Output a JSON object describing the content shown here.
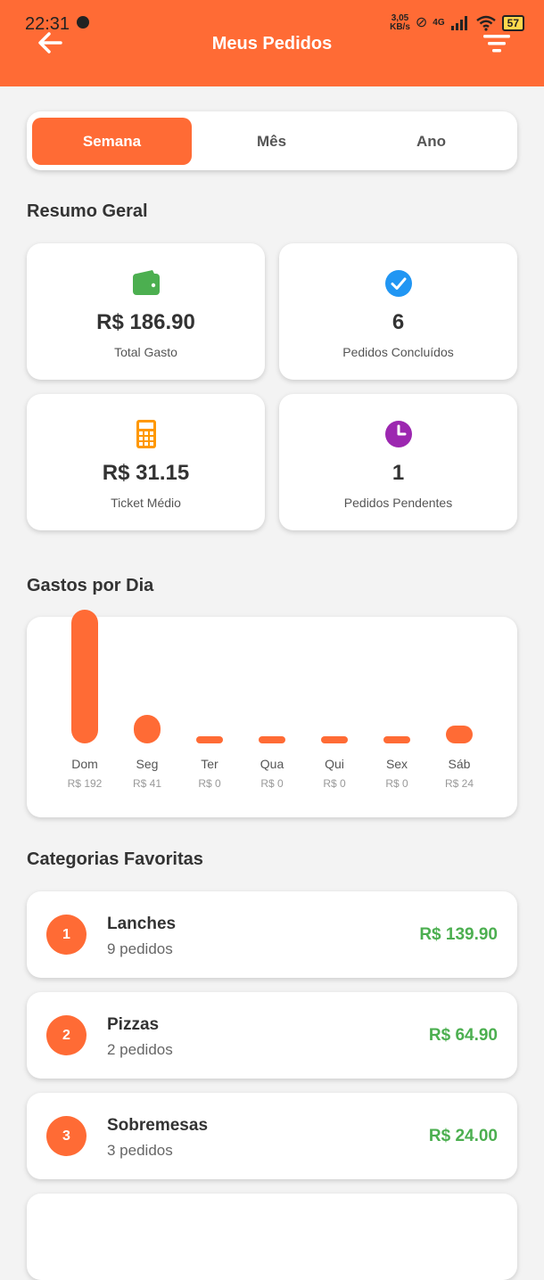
{
  "status": {
    "time": "22:31",
    "speed": "3,05",
    "speed_unit": "KB/s",
    "network": "4G",
    "battery": "57"
  },
  "header": {
    "title": "Meus Pedidos"
  },
  "tabs": [
    {
      "label": "Semana",
      "active": true
    },
    {
      "label": "Mês",
      "active": false
    },
    {
      "label": "Ano",
      "active": false
    }
  ],
  "summary": {
    "title": "Resumo Geral",
    "cards": [
      {
        "value": "R$ 186.90",
        "label": "Total Gasto",
        "icon": "wallet-icon",
        "color": "#4caf50"
      },
      {
        "value": "6",
        "label": "Pedidos Concluídos",
        "icon": "check-circle-icon",
        "color": "#2196f3"
      },
      {
        "value": "R$ 31.15",
        "label": "Ticket Médio",
        "icon": "calculator-icon",
        "color": "#ff9800"
      },
      {
        "value": "1",
        "label": "Pedidos Pendentes",
        "icon": "clock-icon",
        "color": "#9c27b0"
      }
    ]
  },
  "spending": {
    "title": "Gastos por Dia",
    "days": [
      {
        "label": "Dom",
        "value_label": "R$ 192"
      },
      {
        "label": "Seg",
        "value_label": "R$ 41"
      },
      {
        "label": "Ter",
        "value_label": "R$ 0"
      },
      {
        "label": "Qua",
        "value_label": "R$ 0"
      },
      {
        "label": "Qui",
        "value_label": "R$ 0"
      },
      {
        "label": "Sex",
        "value_label": "R$ 0"
      },
      {
        "label": "Sáb",
        "value_label": "R$ 24"
      }
    ]
  },
  "chart_data": {
    "type": "bar",
    "categories": [
      "Dom",
      "Seg",
      "Ter",
      "Qua",
      "Qui",
      "Sex",
      "Sáb"
    ],
    "values": [
      192,
      41,
      0,
      0,
      0,
      0,
      24
    ],
    "color": "#ff6b35"
  },
  "categories": {
    "title": "Categorias Favoritas",
    "items": [
      {
        "rank": "1",
        "name": "Lanches",
        "count": "9 pedidos",
        "amount": "R$ 139.90"
      },
      {
        "rank": "2",
        "name": "Pizzas",
        "count": "2 pedidos",
        "amount": "R$ 64.90"
      },
      {
        "rank": "3",
        "name": "Sobremesas",
        "count": "3 pedidos",
        "amount": "R$ 24.00"
      }
    ]
  },
  "colors": {
    "primary": "#ff6b35",
    "amount": "#4caf50",
    "background": "#f3f3f3"
  }
}
